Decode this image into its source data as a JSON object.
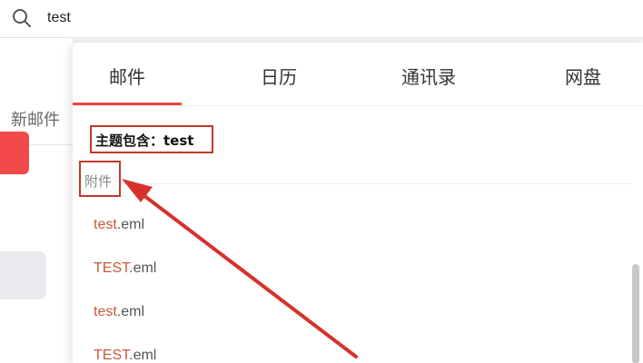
{
  "search": {
    "query": "test"
  },
  "sidebar": {
    "new_mail": "新邮件"
  },
  "tabs": [
    {
      "label": "邮件",
      "active": true
    },
    {
      "label": "日历",
      "active": false
    },
    {
      "label": "通讯录",
      "active": false
    },
    {
      "label": "网盘",
      "active": false
    }
  ],
  "subject_filter": "主题包含：test",
  "attachments": {
    "heading": "附件",
    "items": [
      {
        "match": "test",
        "ext": ".eml"
      },
      {
        "match": "TEST",
        "ext": ".eml"
      },
      {
        "match": "test",
        "ext": ".eml"
      },
      {
        "match": "TEST",
        "ext": ".eml"
      }
    ]
  },
  "colors": {
    "accent": "#e84545",
    "annotation": "#c0392b",
    "highlight": "#c85a3c"
  }
}
